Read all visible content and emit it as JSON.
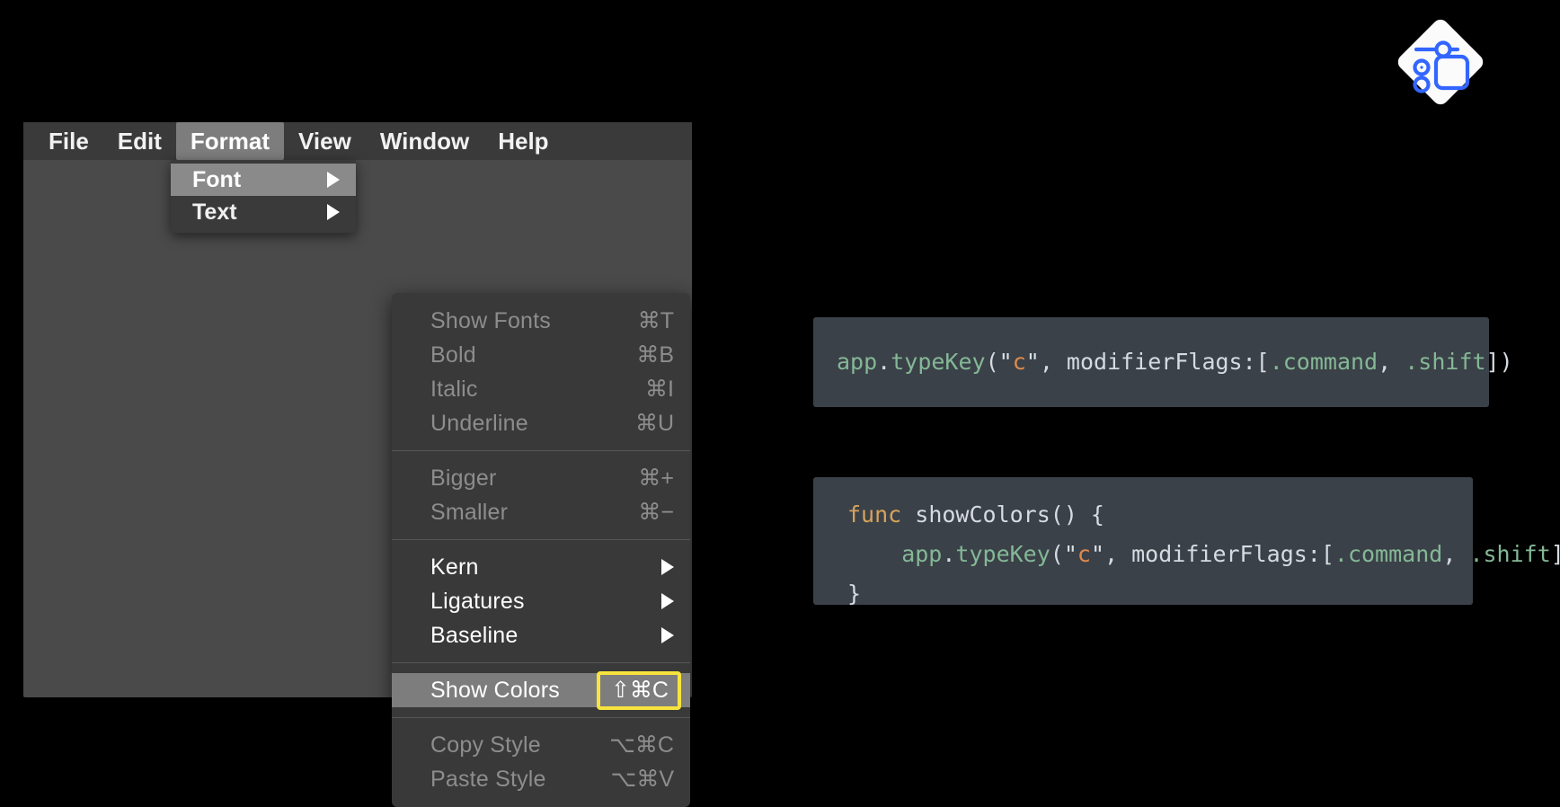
{
  "logo": {
    "name": "settings-diamond-logo",
    "diamond_color": "#fbfbfb",
    "glyph_color": "#3366ff"
  },
  "app_window": {
    "background": "#4a4a4a",
    "menubar": {
      "background": "#3a3a3a",
      "items": [
        {
          "label": "File",
          "active": false
        },
        {
          "label": "Edit",
          "active": false
        },
        {
          "label": "Format",
          "active": true
        },
        {
          "label": "View",
          "active": false
        },
        {
          "label": "Window",
          "active": false
        },
        {
          "label": "Help",
          "active": false
        }
      ]
    },
    "format_menu": {
      "items": [
        {
          "label": "Font",
          "submenu": true,
          "highlight": true
        },
        {
          "label": "Text",
          "submenu": true,
          "highlight": false
        }
      ]
    },
    "font_submenu": {
      "highlight_color": "#f7e33d",
      "groups": [
        {
          "rows": [
            {
              "label": "Show Fonts",
              "shortcut": "⌘T",
              "state": "disabled"
            },
            {
              "label": "Bold",
              "shortcut": "⌘B",
              "state": "disabled"
            },
            {
              "label": "Italic",
              "shortcut": "⌘I",
              "state": "disabled"
            },
            {
              "label": "Underline",
              "shortcut": "⌘U",
              "state": "disabled"
            }
          ]
        },
        {
          "rows": [
            {
              "label": "Bigger",
              "shortcut": "⌘+",
              "state": "disabled"
            },
            {
              "label": "Smaller",
              "shortcut": "⌘−",
              "state": "disabled"
            }
          ]
        },
        {
          "rows": [
            {
              "label": "Kern",
              "shortcut": "",
              "state": "enabled",
              "submenu": true
            },
            {
              "label": "Ligatures",
              "shortcut": "",
              "state": "enabled",
              "submenu": true
            },
            {
              "label": "Baseline",
              "shortcut": "",
              "state": "enabled",
              "submenu": true
            }
          ]
        },
        {
          "rows": [
            {
              "label": "Show Colors",
              "shortcut": "⇧⌘C",
              "state": "selected",
              "boxed_shortcut": true
            }
          ]
        },
        {
          "rows": [
            {
              "label": "Copy Style",
              "shortcut": "⌥⌘C",
              "state": "disabled"
            },
            {
              "label": "Paste Style",
              "shortcut": "⌥⌘V",
              "state": "disabled"
            }
          ]
        }
      ]
    }
  },
  "code_blocks": [
    {
      "name": "typekey-snippet",
      "background": "#3b4148",
      "lines": [
        [
          {
            "t": "app",
            "c": "fn"
          },
          {
            "t": ".",
            "c": "plain"
          },
          {
            "t": "typeKey",
            "c": "fn"
          },
          {
            "t": "(",
            "c": "plain"
          },
          {
            "t": "\"",
            "c": "str"
          },
          {
            "t": "c",
            "c": "chr"
          },
          {
            "t": "\"",
            "c": "str"
          },
          {
            "t": ", modifierFlags:[",
            "c": "plain"
          },
          {
            "t": ".command",
            "c": "enum"
          },
          {
            "t": ", ",
            "c": "plain"
          },
          {
            "t": ".shift",
            "c": "enum"
          },
          {
            "t": "])",
            "c": "plain"
          }
        ]
      ]
    },
    {
      "name": "showcolors-func-snippet",
      "background": "#3b4148",
      "lines": [
        [
          {
            "t": "func",
            "c": "kw"
          },
          {
            "t": " showColors() {",
            "c": "plain"
          }
        ],
        [
          {
            "t": "    app",
            "c": "fn"
          },
          {
            "t": ".",
            "c": "plain"
          },
          {
            "t": "typeKey",
            "c": "fn"
          },
          {
            "t": "(",
            "c": "plain"
          },
          {
            "t": "\"",
            "c": "str"
          },
          {
            "t": "c",
            "c": "chr"
          },
          {
            "t": "\"",
            "c": "str"
          },
          {
            "t": ", modifierFlags:[",
            "c": "plain"
          },
          {
            "t": ".command",
            "c": "enum"
          },
          {
            "t": ", ",
            "c": "plain"
          },
          {
            "t": ".shift",
            "c": "enum"
          },
          {
            "t": "])",
            "c": "plain"
          }
        ],
        [
          {
            "t": "}",
            "c": "plain"
          }
        ]
      ]
    }
  ]
}
